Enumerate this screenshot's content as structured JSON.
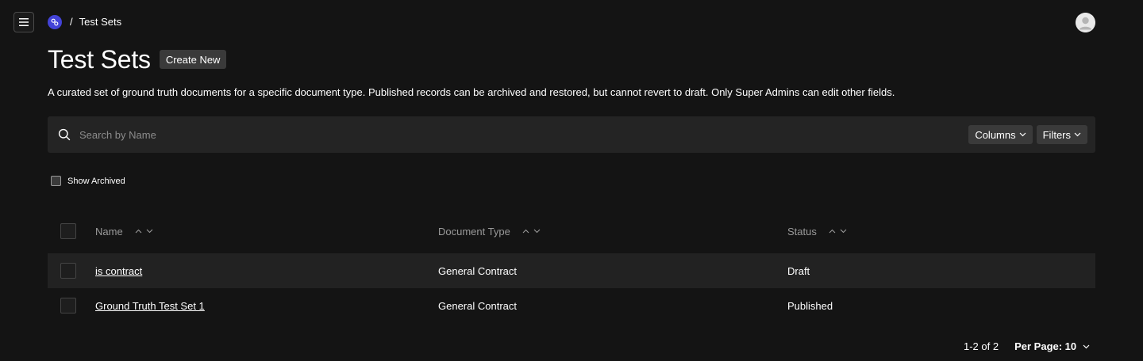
{
  "nav": {
    "breadcrumb_separator": "/",
    "breadcrumb_current": "Test Sets"
  },
  "header": {
    "title": "Test Sets",
    "create_label": "Create New"
  },
  "description": "A curated set of ground truth documents for a specific document type. Published records can be archived and restored, but cannot revert to draft. Only Super Admins can edit other fields.",
  "search": {
    "placeholder": "Search by Name",
    "value": ""
  },
  "toolbar": {
    "columns_label": "Columns",
    "filters_label": "Filters"
  },
  "show_archived": {
    "label": "Show Archived",
    "checked": false
  },
  "table": {
    "columns": [
      "Name",
      "Document Type",
      "Status"
    ],
    "rows": [
      {
        "name": "is contract",
        "document_type": "General Contract",
        "status": "Draft"
      },
      {
        "name": "Ground Truth Test Set 1",
        "document_type": "General Contract",
        "status": "Published"
      }
    ]
  },
  "pagination": {
    "range": "1-2 of 2",
    "per_page_label": "Per Page: 10"
  },
  "colors": {
    "background": "#141414",
    "toolbar": "#242424",
    "button": "#3a3a3a",
    "logo": "#4343d8",
    "striped_row": "#222222"
  },
  "icons": [
    "menu-icon",
    "logo-icon",
    "user-avatar-icon",
    "search-icon",
    "chevron-down-icon",
    "sort-asc-icon",
    "sort-desc-icon"
  ]
}
